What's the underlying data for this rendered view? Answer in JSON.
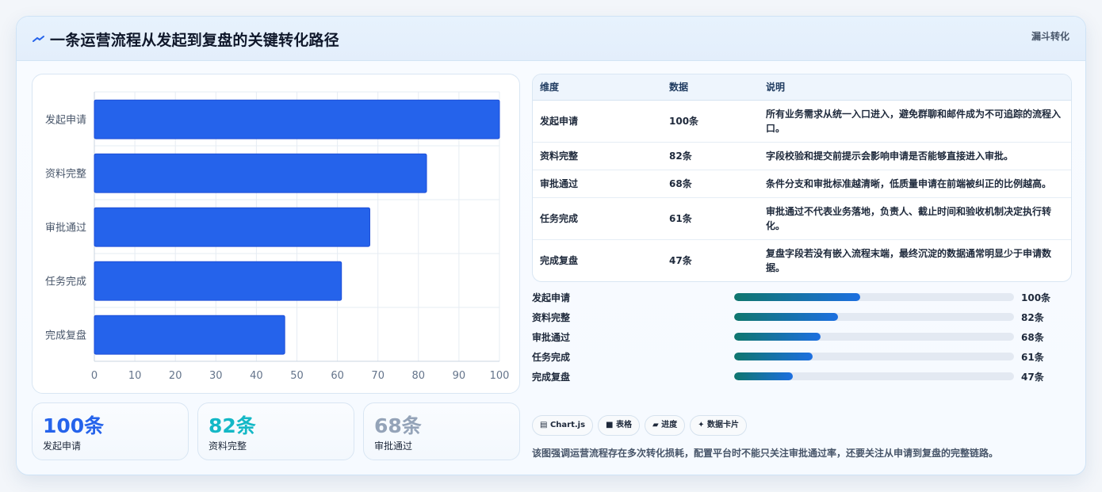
{
  "header": {
    "icon": "flow-line-icon",
    "title": "一条运营流程从发起到复盘的关键转化路径",
    "tag": "漏斗转化"
  },
  "chart_data": {
    "type": "bar",
    "orientation": "horizontal",
    "categories": [
      "发起申请",
      "资料完整",
      "审批通过",
      "任务完成",
      "完成复盘"
    ],
    "values": [
      100,
      82,
      68,
      61,
      47
    ],
    "xlim": [
      0,
      100
    ],
    "xticks": [
      0,
      10,
      20,
      30,
      40,
      50,
      60,
      70,
      80,
      90,
      100
    ],
    "grid": true,
    "color": "#2563eb"
  },
  "stats": [
    {
      "value": "100条",
      "label": "发起申请",
      "color": "#2563eb"
    },
    {
      "value": "82条",
      "label": "资料完整",
      "color": "#14b8c6"
    },
    {
      "value": "68条",
      "label": "审批通过",
      "color": "#94a3b8"
    }
  ],
  "table": {
    "headers": [
      "维度",
      "数据",
      "说明"
    ],
    "rows": [
      {
        "dim": "发起申请",
        "data": "100条",
        "desc": "所有业务需求从统一入口进入，避免群聊和邮件成为不可追踪的流程入口。"
      },
      {
        "dim": "资料完整",
        "data": "82条",
        "desc": "字段校验和提交前提示会影响申请是否能够直接进入审批。"
      },
      {
        "dim": "审批通过",
        "data": "68条",
        "desc": "条件分支和审批标准越清晰，低质量申请在前端被纠正的比例越高。"
      },
      {
        "dim": "任务完成",
        "data": "61条",
        "desc": "审批通过不代表业务落地，负责人、截止时间和验收机制决定执行转化。"
      },
      {
        "dim": "完成复盘",
        "data": "47条",
        "desc": "复盘字段若没有嵌入流程末端，最终沉淀的数据通常明显少于申请数据。"
      }
    ]
  },
  "progress": [
    {
      "label": "发起申请",
      "value": "100条",
      "fraction": 0.45
    },
    {
      "label": "资料完整",
      "value": "82条",
      "fraction": 0.37
    },
    {
      "label": "审批通过",
      "value": "68条",
      "fraction": 0.31
    },
    {
      "label": "任务完成",
      "value": "61条",
      "fraction": 0.28
    },
    {
      "label": "完成复盘",
      "value": "47条",
      "fraction": 0.21
    }
  ],
  "chips": [
    {
      "icon": "chart-icon",
      "glyph": "▤",
      "label": "Chart.js"
    },
    {
      "icon": "table-icon",
      "glyph": "■",
      "label": "表格"
    },
    {
      "icon": "progress-icon",
      "glyph": "▰",
      "label": "进度"
    },
    {
      "icon": "card-icon",
      "glyph": "✦",
      "label": "数据卡片"
    }
  ],
  "note": "该图强调运营流程存在多次转化损耗，配置平台时不能只关注审批通过率，还要关注从申请到复盘的完整链路。"
}
